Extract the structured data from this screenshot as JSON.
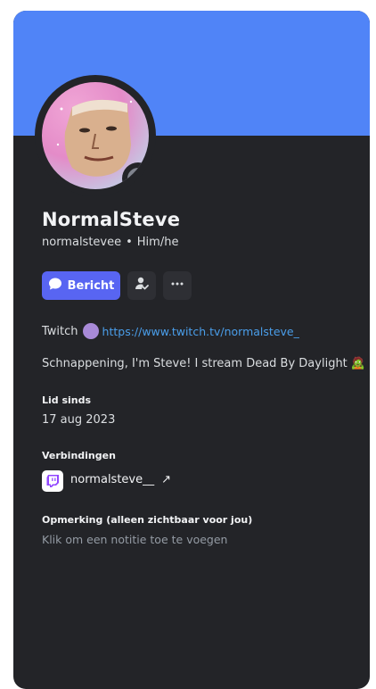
{
  "profile": {
    "display_name": "NormalSteve",
    "username": "normalstevee",
    "separator": "•",
    "pronouns": "Him/he",
    "status": "offline"
  },
  "actions": {
    "message_label": "Bericht",
    "message_icon": "chat-bubble-icon",
    "add_friend_icon": "person-check-icon",
    "more_icon": "ellipsis-icon"
  },
  "bio": {
    "line1_text": "Twitch",
    "line1_emote": "purple-circle-emote",
    "line1_link": "https://www.twitch.tv/normalsteve_",
    "line2_text": "Schnappening, I'm Steve! I stream Dead By Daylight",
    "line2_emoji": "🧟"
  },
  "member_since": {
    "title": "Lid sinds",
    "value": "17 aug 2023"
  },
  "connections": {
    "title": "Verbindingen",
    "items": [
      {
        "service": "twitch",
        "icon": "twitch-icon",
        "name": "normalsteve__",
        "external_icon": "↗"
      }
    ]
  },
  "note": {
    "title": "Opmerking (alleen zichtbaar voor jou)",
    "placeholder": "Klik om een notitie toe te voegen"
  },
  "colors": {
    "banner": "#5084f7",
    "card": "#232428",
    "accent": "#5865f2",
    "link": "#4a9eea"
  }
}
